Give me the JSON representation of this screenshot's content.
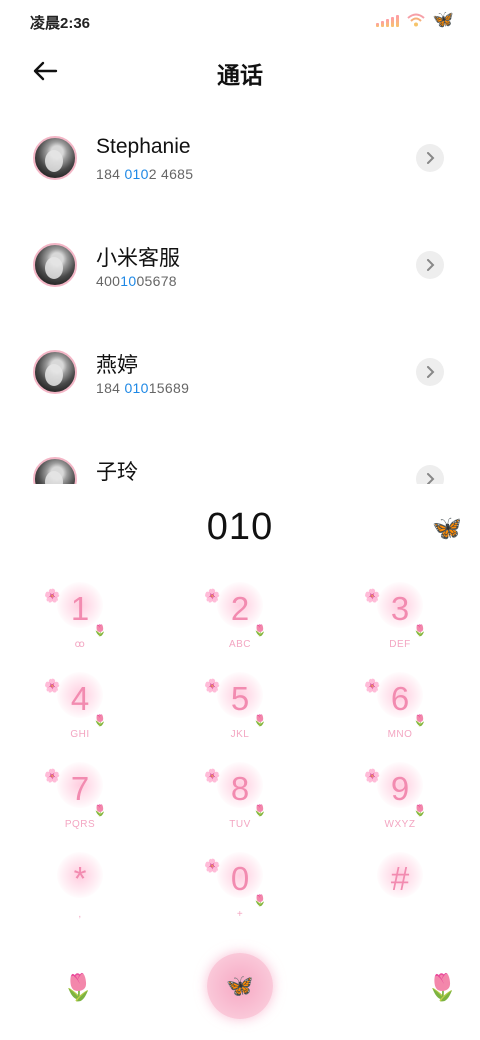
{
  "status_bar": {
    "time": "凌晨2:36",
    "icons": [
      "signal-icon",
      "wifi-icon",
      "butterfly-icon"
    ]
  },
  "header": {
    "back_icon": "back-arrow-icon",
    "title": "通话"
  },
  "contacts": [
    {
      "name": "Stephanie",
      "number_pre": "184 ",
      "number_match": "010",
      "number_post": "2 4685"
    },
    {
      "name": "小米客服",
      "number_pre": "400",
      "number_match": "10",
      "number_post": "05678"
    },
    {
      "name": "燕婷",
      "number_pre": "184 ",
      "number_match": "010",
      "number_post": "15689"
    },
    {
      "name": "子玲",
      "number_pre": "",
      "number_match": "",
      "number_post": ""
    }
  ],
  "dial": {
    "number": "010",
    "decoration_icon": "butterfly-icon"
  },
  "keypad": [
    {
      "digit": "1",
      "letters": "ꝏ"
    },
    {
      "digit": "2",
      "letters": "ABC"
    },
    {
      "digit": "3",
      "letters": "DEF"
    },
    {
      "digit": "4",
      "letters": "GHI"
    },
    {
      "digit": "5",
      "letters": "JKL"
    },
    {
      "digit": "6",
      "letters": "MNO"
    },
    {
      "digit": "7",
      "letters": "PQRS"
    },
    {
      "digit": "8",
      "letters": "TUV"
    },
    {
      "digit": "9",
      "letters": "WXYZ"
    },
    {
      "digit": "*",
      "letters": ","
    },
    {
      "digit": "0",
      "letters": "+"
    },
    {
      "digit": "#",
      "letters": ""
    }
  ],
  "bottom": {
    "left_icon": "tulip-icon",
    "call_icon": "butterfly-icon",
    "right_icon": "tulip-icon"
  },
  "colors": {
    "accent_pink": "#f28bb0",
    "highlight_blue": "#1e88e5"
  }
}
